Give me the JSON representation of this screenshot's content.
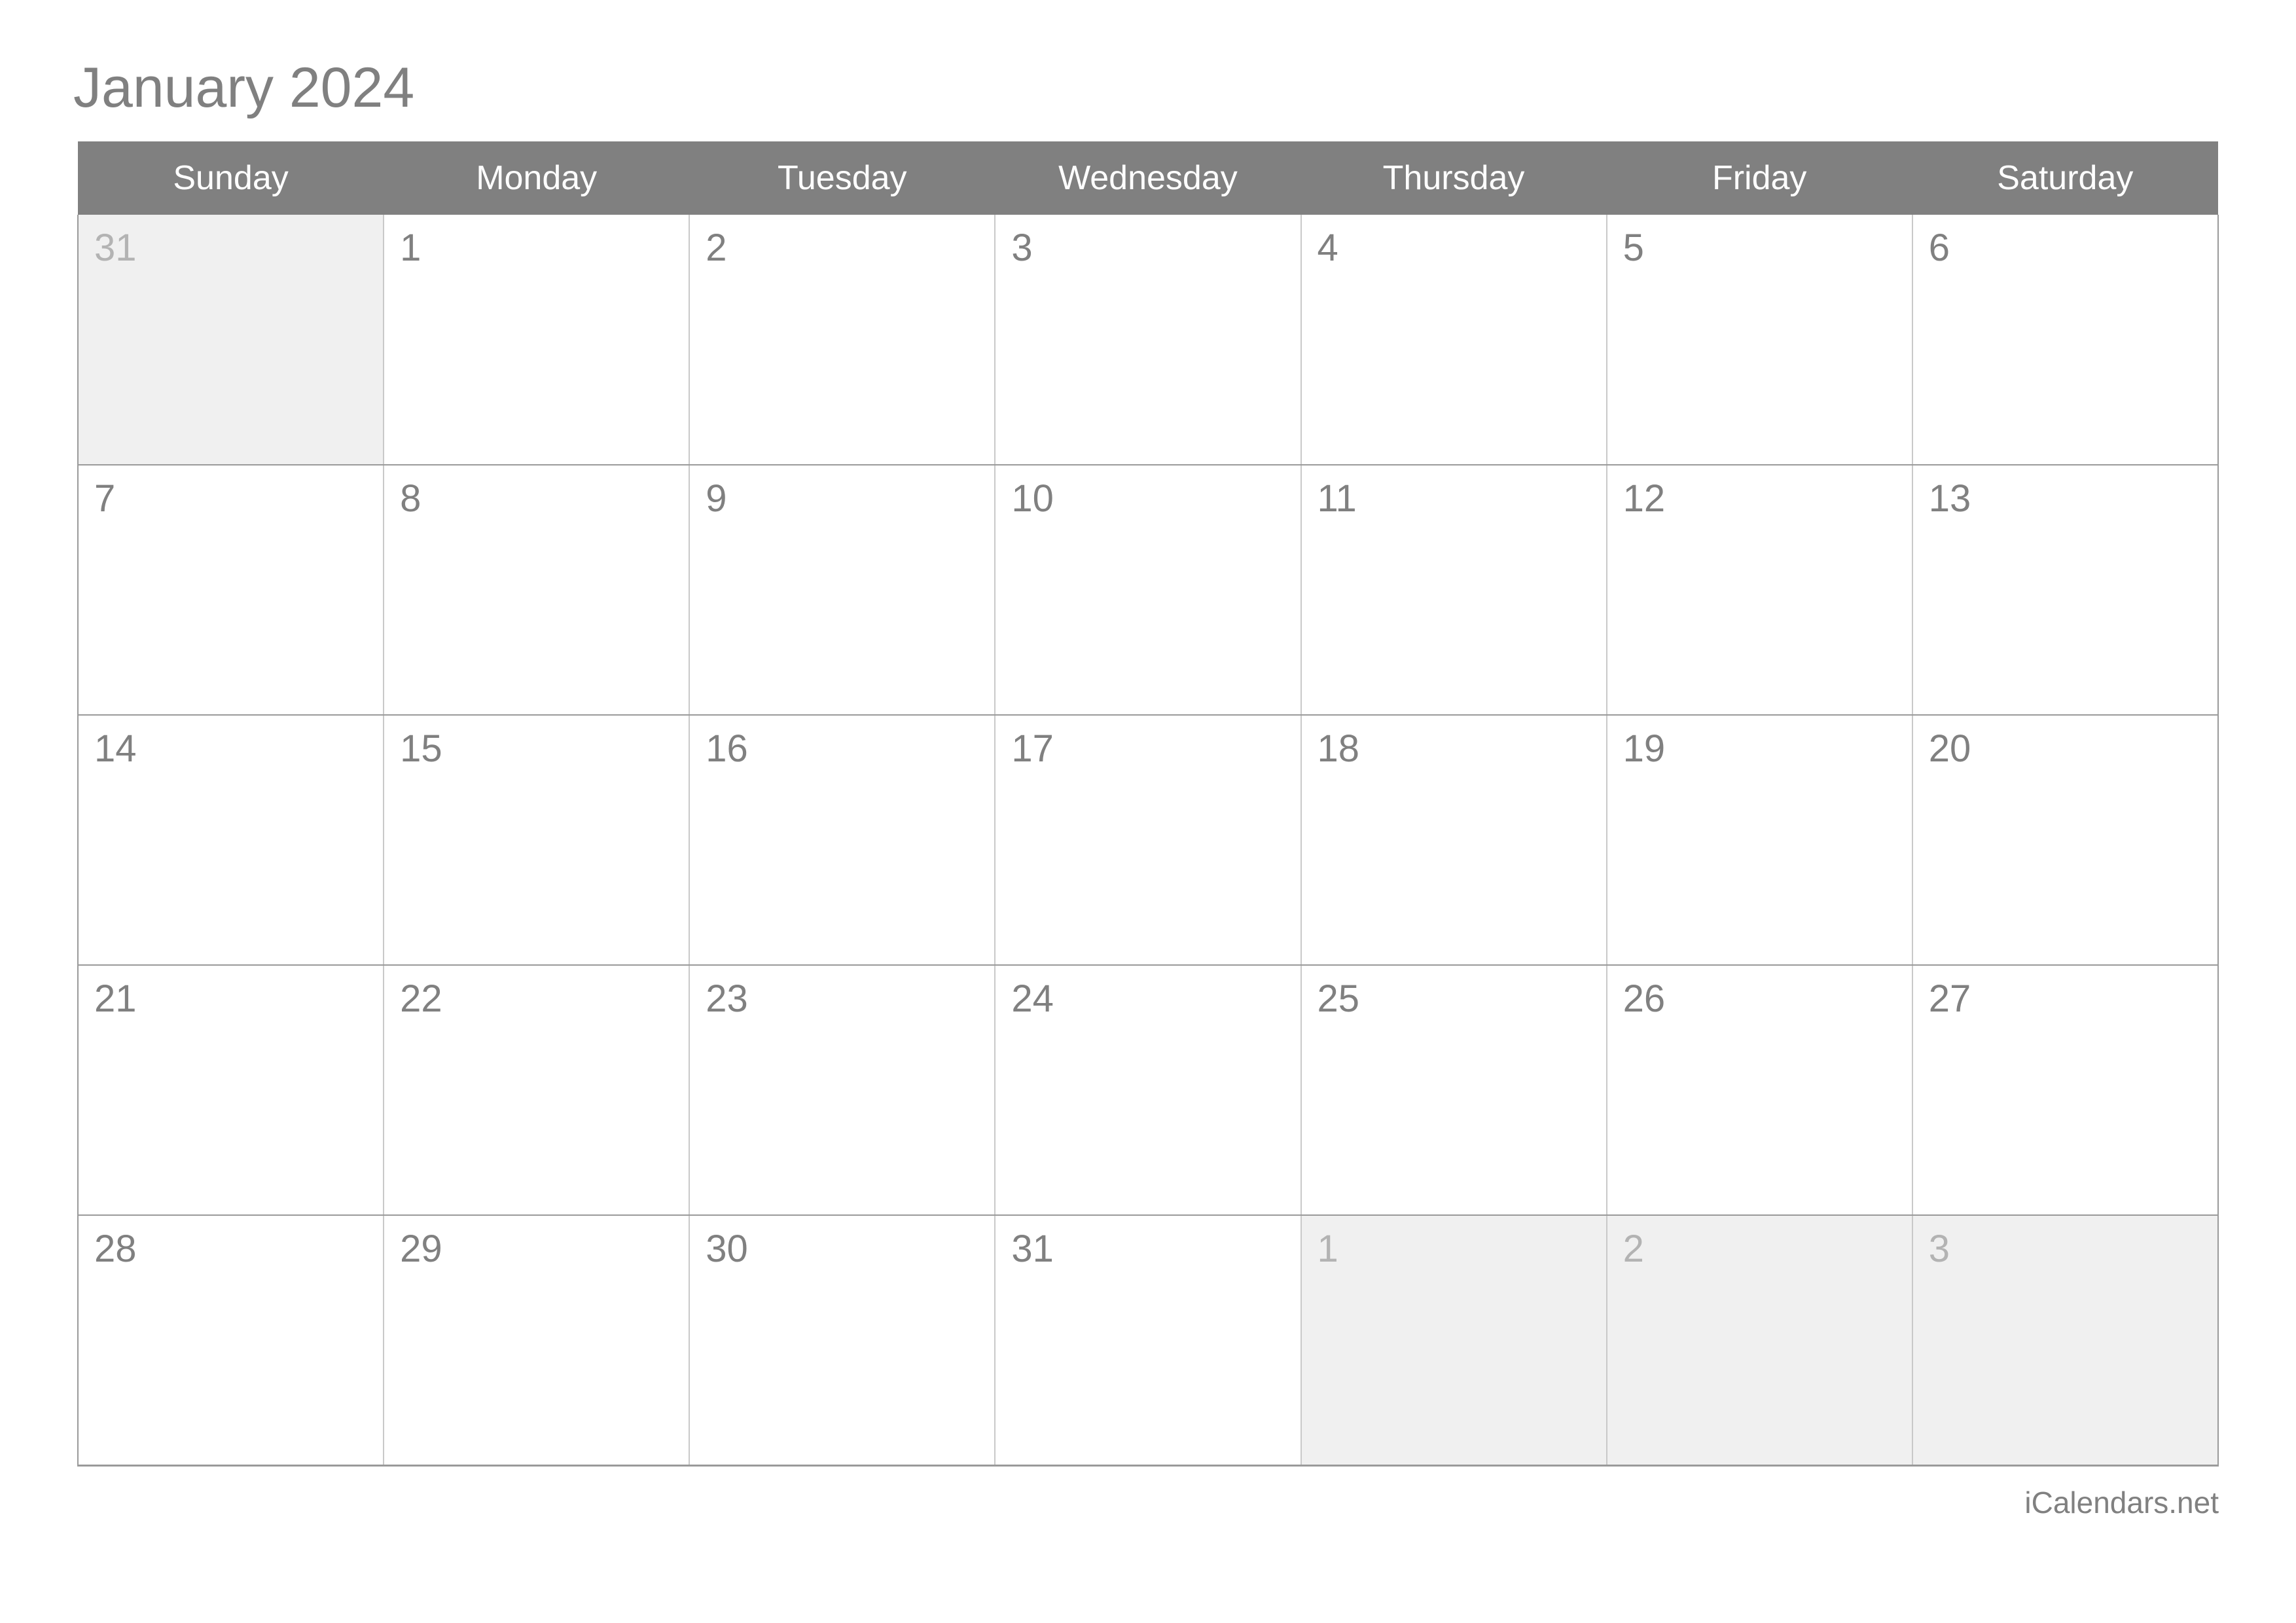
{
  "calendar": {
    "title": "January 2024",
    "month": "January",
    "year": "2024",
    "weekdays": [
      "Sunday",
      "Monday",
      "Tuesday",
      "Wednesday",
      "Thursday",
      "Friday",
      "Saturday"
    ],
    "weeks": [
      [
        {
          "day": "31",
          "in_month": false
        },
        {
          "day": "1",
          "in_month": true
        },
        {
          "day": "2",
          "in_month": true
        },
        {
          "day": "3",
          "in_month": true
        },
        {
          "day": "4",
          "in_month": true
        },
        {
          "day": "5",
          "in_month": true
        },
        {
          "day": "6",
          "in_month": true
        }
      ],
      [
        {
          "day": "7",
          "in_month": true
        },
        {
          "day": "8",
          "in_month": true
        },
        {
          "day": "9",
          "in_month": true
        },
        {
          "day": "10",
          "in_month": true
        },
        {
          "day": "11",
          "in_month": true
        },
        {
          "day": "12",
          "in_month": true
        },
        {
          "day": "13",
          "in_month": true
        }
      ],
      [
        {
          "day": "14",
          "in_month": true
        },
        {
          "day": "15",
          "in_month": true
        },
        {
          "day": "16",
          "in_month": true
        },
        {
          "day": "17",
          "in_month": true
        },
        {
          "day": "18",
          "in_month": true
        },
        {
          "day": "19",
          "in_month": true
        },
        {
          "day": "20",
          "in_month": true
        }
      ],
      [
        {
          "day": "21",
          "in_month": true
        },
        {
          "day": "22",
          "in_month": true
        },
        {
          "day": "23",
          "in_month": true
        },
        {
          "day": "24",
          "in_month": true
        },
        {
          "day": "25",
          "in_month": true
        },
        {
          "day": "26",
          "in_month": true
        },
        {
          "day": "27",
          "in_month": true
        }
      ],
      [
        {
          "day": "28",
          "in_month": true
        },
        {
          "day": "29",
          "in_month": true
        },
        {
          "day": "30",
          "in_month": true
        },
        {
          "day": "31",
          "in_month": true
        },
        {
          "day": "1",
          "in_month": false
        },
        {
          "day": "2",
          "in_month": false
        },
        {
          "day": "3",
          "in_month": false
        }
      ]
    ]
  },
  "footer": {
    "brand": "iCalendars.net"
  },
  "colors": {
    "header_background": "#808080",
    "header_text": "#ffffff",
    "in_month_text": "#808080",
    "out_month_text": "#b3b3b3",
    "out_month_background": "#f0f0f0",
    "cell_background": "#ffffff",
    "grid_line": "#9a9a9a",
    "page_background": "#ffffff"
  }
}
